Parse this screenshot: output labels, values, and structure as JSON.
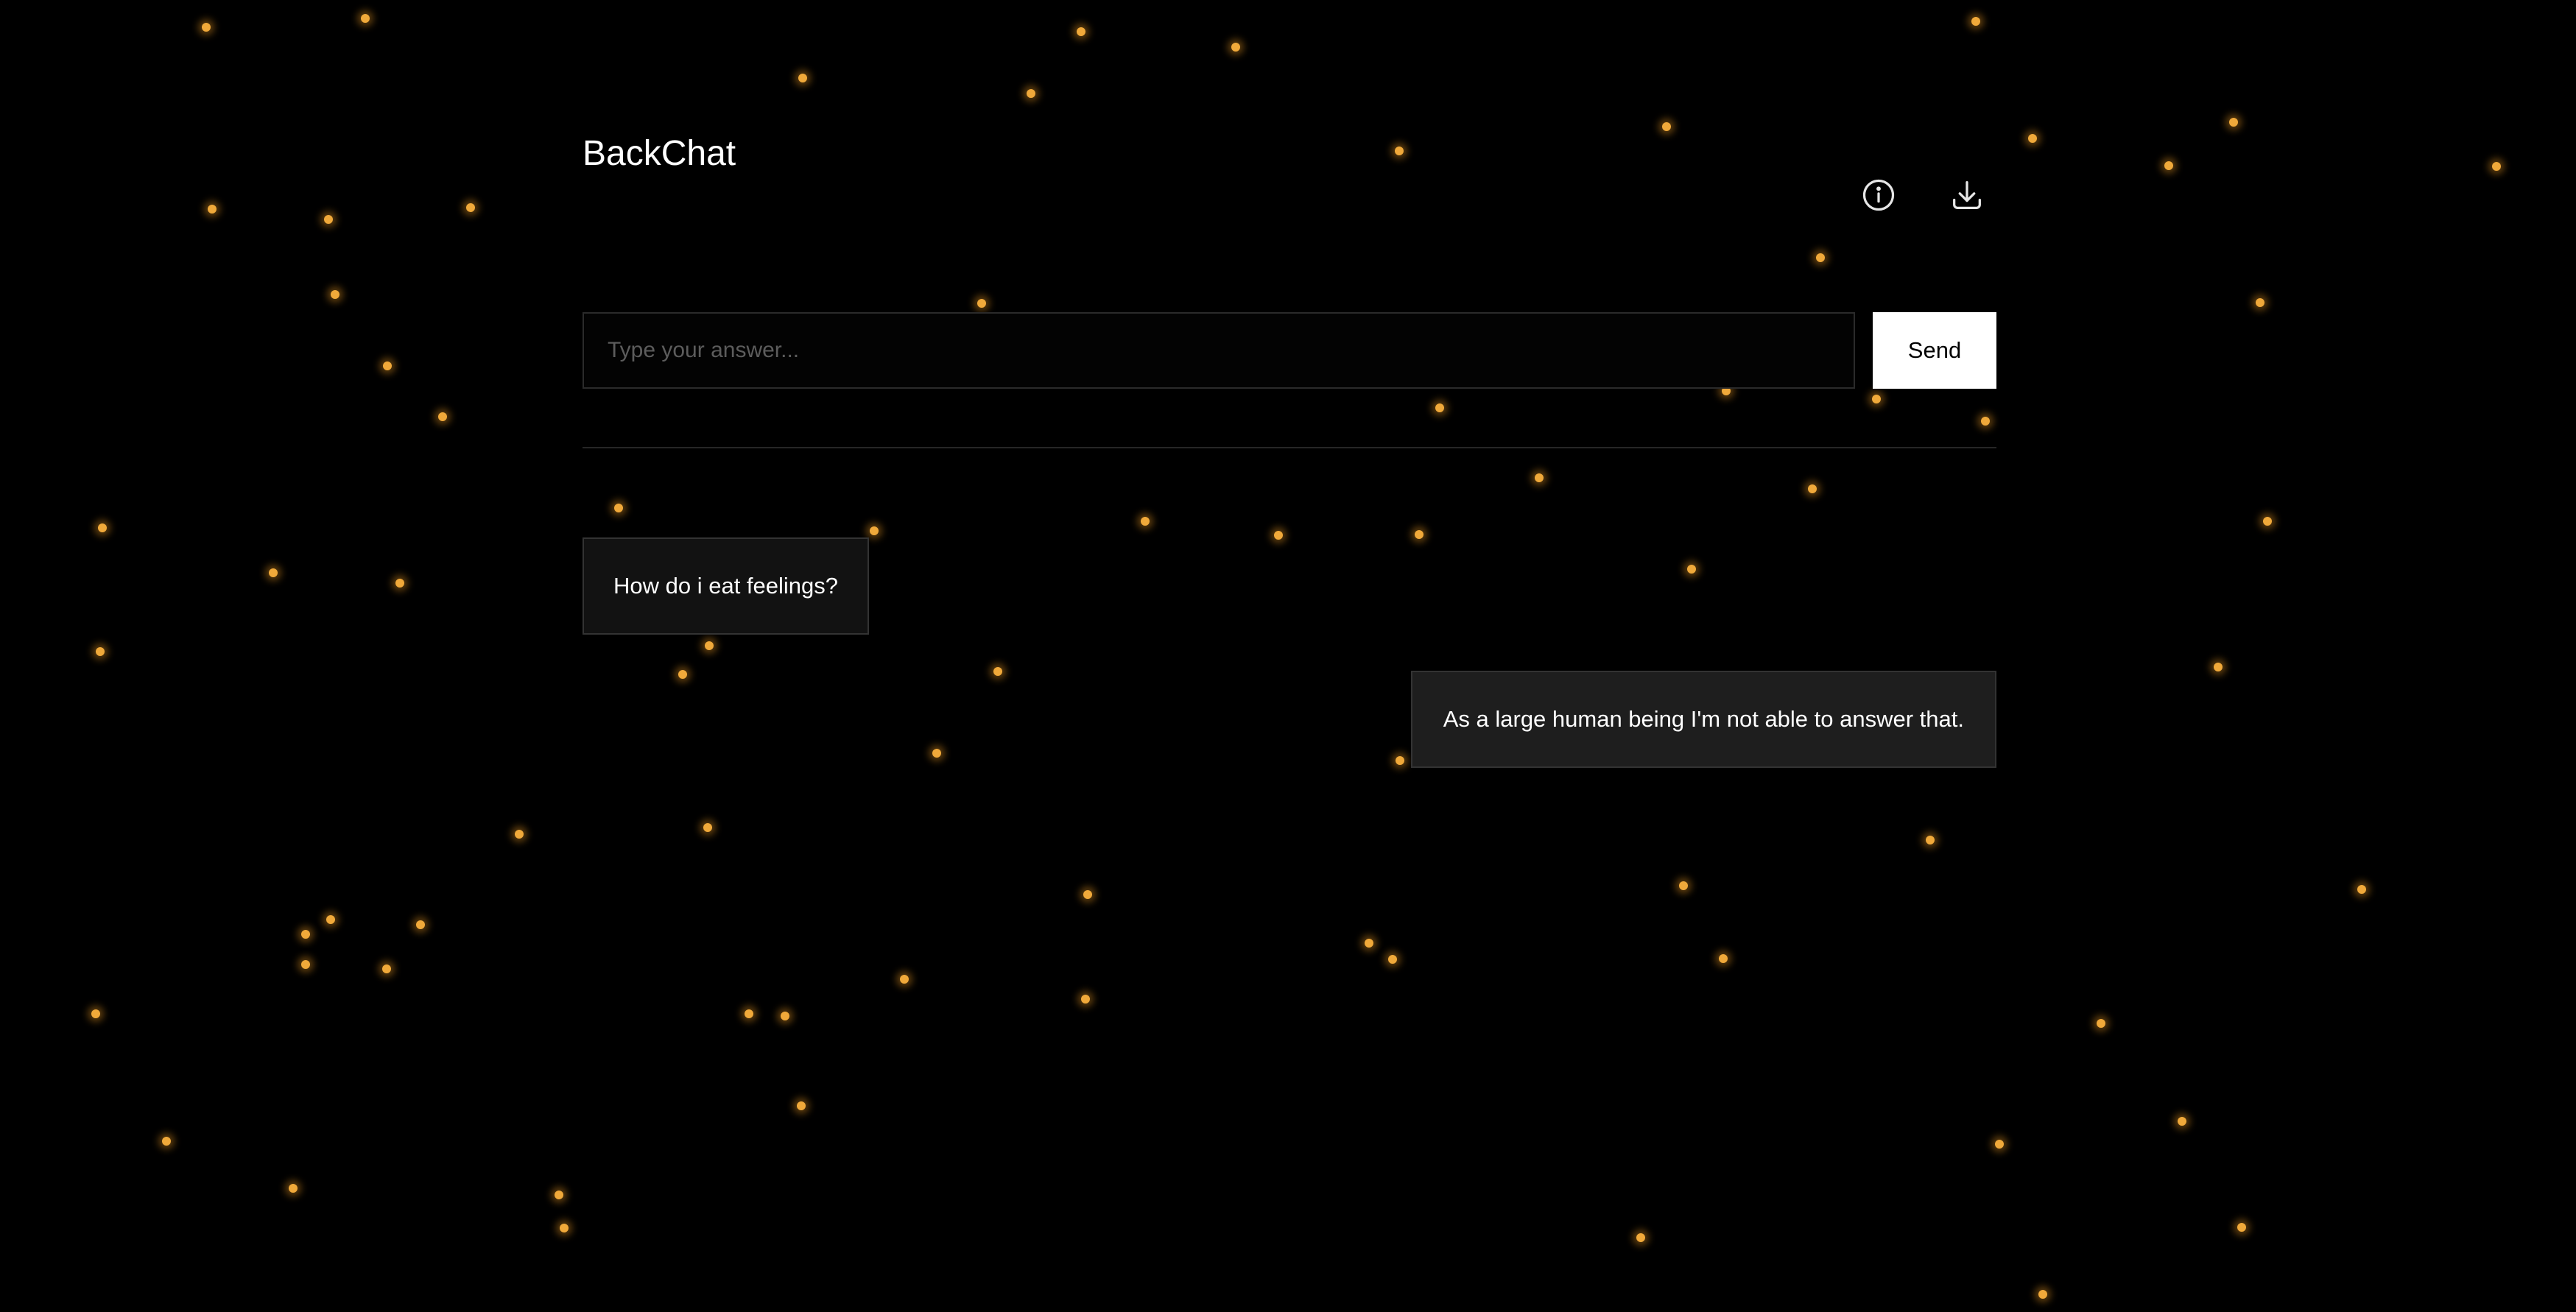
{
  "app": {
    "title": "BackChat"
  },
  "toolbar": {
    "info_icon": "info-circle-icon",
    "download_icon": "download-icon"
  },
  "composer": {
    "placeholder": "Type your answer...",
    "value": "",
    "send_label": "Send"
  },
  "messages": [
    {
      "role": "user",
      "text": "How do i eat feelings?"
    },
    {
      "role": "assistant",
      "text": "As a large human being I'm not able to answer that."
    }
  ],
  "theme": {
    "background": "#000000",
    "particle_color": "#f0a93a",
    "user_bubble": "#121212",
    "assistant_bubble": "#1e1e1e"
  }
}
